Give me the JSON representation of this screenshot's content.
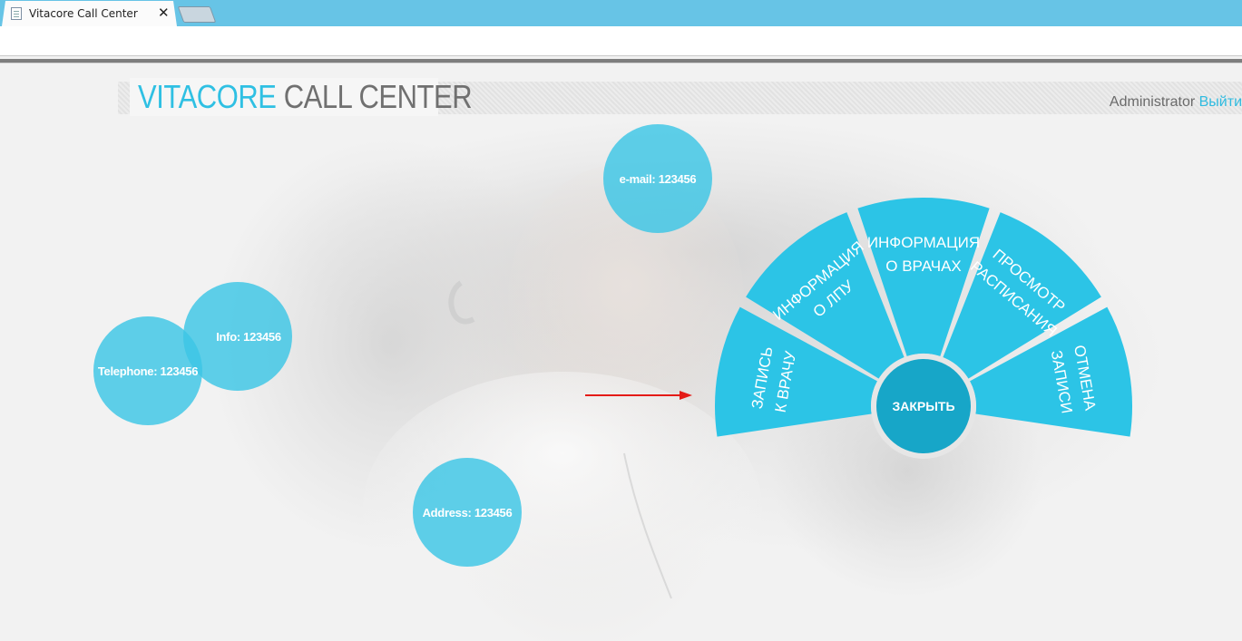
{
  "browser": {
    "tab_title": "Vitacore Call Center",
    "tab_close": "✕"
  },
  "header": {
    "logo_part1": "VITACORE",
    "logo_part2": "CALL CENTER",
    "user_name": "Administrator",
    "logout_label": "Выйти"
  },
  "contacts": {
    "email": "e-mail: 123456",
    "info": "Info: 123456",
    "telephone": "Telephone: 123456",
    "address": "Address: 123456"
  },
  "menu": {
    "items": [
      {
        "id": "book",
        "lines": [
          "ЗАПИСЬ",
          "К ВРАЧУ"
        ]
      },
      {
        "id": "lpu",
        "lines": [
          "ИНФОРМАЦИЯ",
          "О ЛПУ"
        ]
      },
      {
        "id": "doctors",
        "lines": [
          "ИНФОРМАЦИЯ",
          "О ВРАЧАХ"
        ]
      },
      {
        "id": "schedule",
        "lines": [
          "ПРОСМОТР",
          "РАСПИСАНИЯ"
        ]
      },
      {
        "id": "cancel",
        "lines": [
          "ОТМЕНА",
          "ЗАПИСИ"
        ]
      }
    ],
    "close_label": "ЗАКРЫТЬ"
  },
  "colors": {
    "accent": "#2cc4e6",
    "close_button": "#17a6c8",
    "bubble": "#3cc6e5",
    "arrow": "#e41b17"
  }
}
